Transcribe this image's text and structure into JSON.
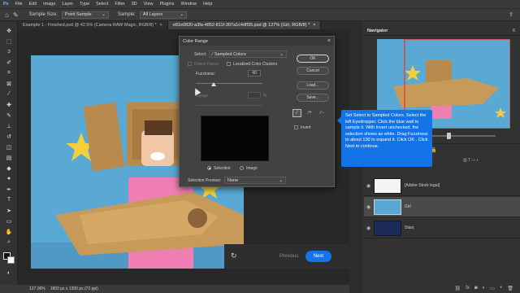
{
  "menu": [
    "File",
    "Edit",
    "Image",
    "Layer",
    "Type",
    "Select",
    "Filter",
    "3D",
    "View",
    "Plugins",
    "Window",
    "Help"
  ],
  "options": {
    "sample_size_label": "Sample Size:",
    "sample_size_value": "Point Sample",
    "sample_label": "Sample:",
    "sample_value": "All Layers"
  },
  "tabs": [
    {
      "label": "Example 1 - Finished.psd @ 42.5% (Camera RAW Magic, RGB/8) *",
      "active": false
    },
    {
      "label": "e81e0820-a3fa-4852-811f-307a1c4dff35.psd @ 127% (Girl, RGB/8) *",
      "active": true
    }
  ],
  "dialog": {
    "title": "Color Range",
    "select_label": "Select:",
    "select_value": "Sampled Colors",
    "detect_faces": "Detect Faces",
    "localized": "Localized Color Clusters",
    "fuzziness_label": "Fuzziness:",
    "fuzziness_value": "40",
    "range_label": "Range:",
    "range_unit": "%",
    "selection_label": "Selection",
    "image_label": "Image",
    "preview_label": "Selection Preview:",
    "preview_value": "None",
    "ok": "OK",
    "cancel": "Cancel",
    "load": "Load...",
    "save": "Save...",
    "invert": "Invert"
  },
  "tooltip": "Set Select to Sampled Colors. Select the left Eyedropper. Click the blue wall to sample it. With Invert unchecked, the selection shows as white. Drag Fuzziness to about 130 to expand it. Click OK . Click Next to continue.",
  "nav": {
    "previous": "Previous",
    "next": "Next"
  },
  "status": {
    "zoom": "127.06%",
    "doc": "1800 px x 1200 px (72 ppi)"
  },
  "panels": {
    "navigator": "Navigator",
    "layers": [
      {
        "name": "[Adobe Stock legal]"
      },
      {
        "name": "Girl"
      },
      {
        "name": "Stars"
      }
    ]
  },
  "colors": {
    "accent": "#1473e6",
    "sky": "#5aa9d4",
    "panel": "#323232"
  }
}
